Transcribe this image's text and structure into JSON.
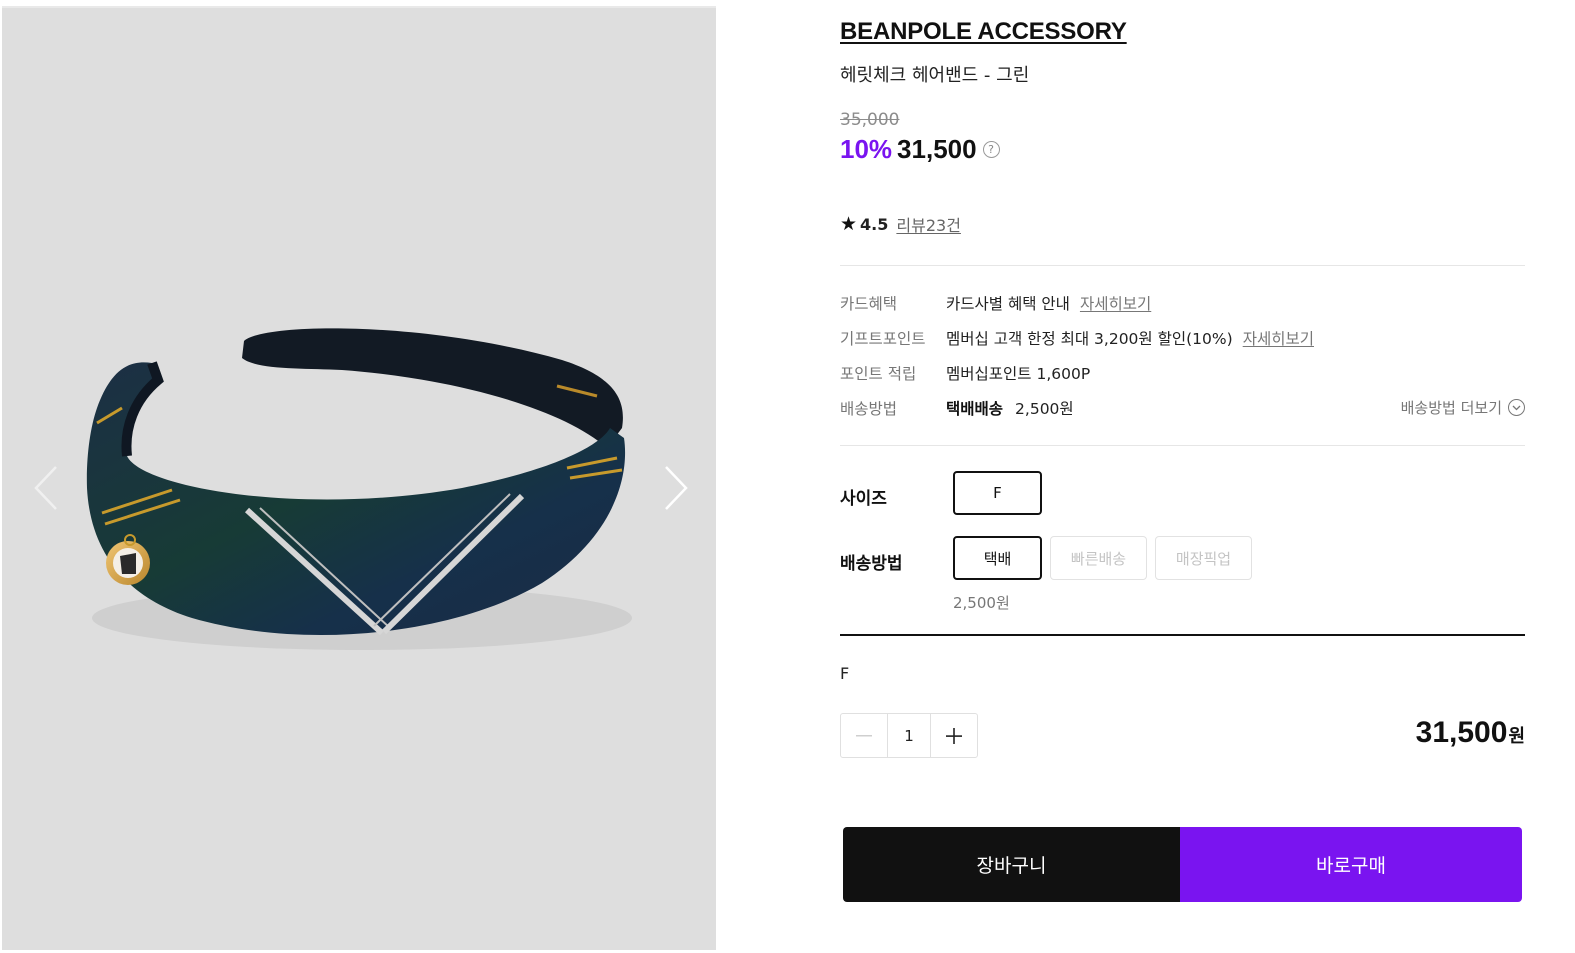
{
  "gallery": {
    "image_alt": "헤릿체크 헤어밴드 - 그린",
    "prev_icon": "chevron-left-icon",
    "next_icon": "chevron-right-icon"
  },
  "product": {
    "brand": "BEANPOLE ACCESSORY",
    "name": "헤릿체크 헤어밴드 - 그린",
    "original_price": "35,000",
    "discount_rate": "10%",
    "sale_price": "31,500",
    "help_icon_text": "?",
    "rating": "4.5",
    "review_label": "리뷰23건"
  },
  "benefits": [
    {
      "label": "카드혜택",
      "value": "카드사별 혜택 안내",
      "link": "자세히보기"
    },
    {
      "label": "기프트포인트",
      "value": "멤버십 고객 한정 최대 3,200원 할인(10%)",
      "link": "자세히보기"
    },
    {
      "label": "포인트 적립",
      "value": "멤버십포인트 1,600P"
    },
    {
      "label": "배송방법",
      "strong": "택배배송",
      "value": "2,500원",
      "more": "배송방법 더보기"
    }
  ],
  "options": {
    "size_label": "사이즈",
    "size_value": "F",
    "delivery_label": "배송방법",
    "delivery_choices": [
      "택배",
      "빠른배송",
      "매장픽업"
    ],
    "delivery_fee": "2,500원"
  },
  "selection": {
    "name": "F",
    "quantity": "1",
    "total": "31,500",
    "currency": "원"
  },
  "actions": {
    "cart": "장바구니",
    "buy": "바로구매"
  },
  "colors": {
    "accent": "#7a14f0",
    "dark": "#111111",
    "gallery_bg": "#dedede"
  }
}
